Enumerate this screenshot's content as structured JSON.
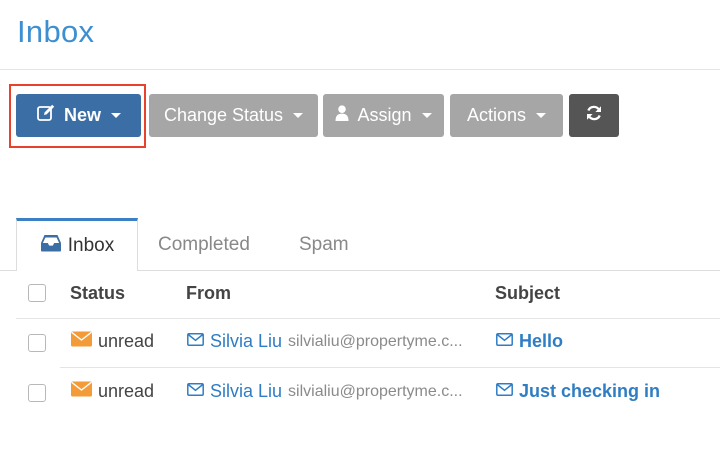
{
  "page": {
    "title": "Inbox"
  },
  "toolbar": {
    "new_label": "New",
    "change_status_label": "Change Status",
    "assign_label": "Assign",
    "actions_label": "Actions"
  },
  "tabs": [
    {
      "label": "Inbox",
      "active": true
    },
    {
      "label": "Completed",
      "active": false
    },
    {
      "label": "Spam",
      "active": false
    }
  ],
  "table": {
    "headers": {
      "status": "Status",
      "from": "From",
      "subject": "Subject"
    },
    "rows": [
      {
        "status": "unread",
        "from_name": "Silvia Liu",
        "from_email": "silvialiu@propertyme.c...",
        "subject": "Hello"
      },
      {
        "status": "unread",
        "from_name": "Silvia Liu",
        "from_email": "silvialiu@propertyme.c...",
        "subject": "Just checking in"
      }
    ]
  },
  "icons": {
    "new": "edit-icon",
    "assign": "user-icon",
    "refresh": "refresh-icon",
    "inbox_tab": "inbox-tray-icon",
    "unread": "envelope-filled-icon",
    "mail": "envelope-outline-icon"
  },
  "colors": {
    "title": "#3d8fd1",
    "primary_button": "#3b6ea5",
    "grey_button": "#a6a6a6",
    "dark_button": "#555555",
    "highlight_box": "#e8412c",
    "link": "#2f7dc4",
    "unread_icon": "#f29b38"
  }
}
